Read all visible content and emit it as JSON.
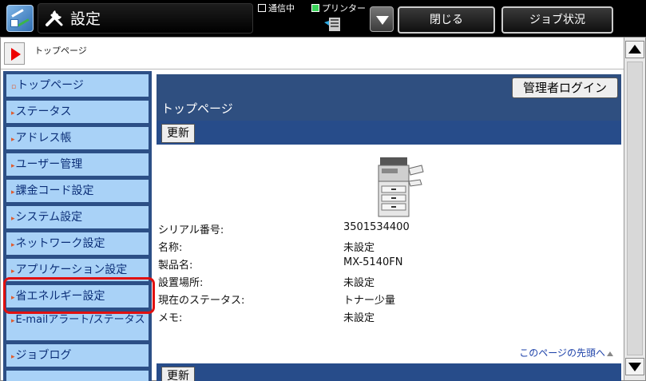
{
  "topbar": {
    "title": "設定",
    "status_comm": "通信中",
    "status_printer": "プリンター",
    "close_label": "閉じる",
    "job_status_label": "ジョブ状況",
    "icons": {
      "app": "mode-switch-icon",
      "tool": "tools-icon",
      "printer": "printer-status-icon",
      "dropdown": "chevron-down-icon"
    }
  },
  "breadcrumb": "トップページ",
  "sidebar": {
    "items": [
      {
        "label": "トップページ"
      },
      {
        "label": "ステータス"
      },
      {
        "label": "アドレス帳"
      },
      {
        "label": "ユーザー管理"
      },
      {
        "label": "課金コード設定"
      },
      {
        "label": "システム設定"
      },
      {
        "label": "ネットワーク設定"
      },
      {
        "label": "アプリケーション設定"
      },
      {
        "label": "省エネルギー設定"
      },
      {
        "label": "E-mailアラート/ステータス"
      },
      {
        "label": "ジョブログ"
      }
    ]
  },
  "main": {
    "admin_login_label": "管理者ログイン",
    "title": "トップページ",
    "refresh_label": "更新",
    "info": [
      {
        "label": "シリアル番号:",
        "value": "3501534400"
      },
      {
        "label": "名称:",
        "value": "未設定"
      },
      {
        "label": "製品名:",
        "value": "MX-5140FN"
      },
      {
        "label": "設置場所:",
        "value": "未設定"
      },
      {
        "label": "現在のステータス:",
        "value": "トナー少量"
      },
      {
        "label": "メモ:",
        "value": "未設定"
      }
    ],
    "to_top_label": "このページの先頭へ"
  },
  "colors": {
    "accent": "#2f4f80",
    "sidebar_item": "#a9d2f7",
    "highlight": "#e01010"
  }
}
